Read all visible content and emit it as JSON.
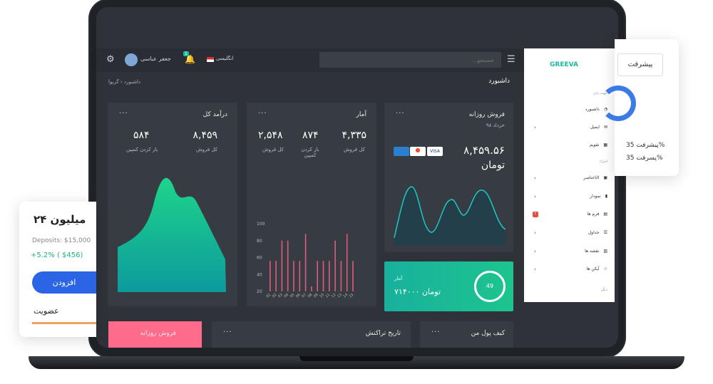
{
  "topbar": {
    "search_placeholder": "جستجو...",
    "language": "انگلیسی",
    "user_name": "جعفر عباسی",
    "notif_count": "1"
  },
  "header": {
    "page_title": "داشبورد",
    "breadcrumb": [
      "داشبورد",
      "گریوا"
    ]
  },
  "sidebar": {
    "logo": "GREEVA",
    "section_nav": "جهت یابی",
    "items": [
      "داشبورد",
      "ایمیل",
      "تقویم"
    ],
    "section_elements": "اجزاء",
    "items2": [
      "عناصرUI",
      "نمودار",
      "فرم ها",
      "جداول",
      "نقشه ها",
      "آیکن ها"
    ],
    "form_badge": "۲",
    "section_other": "دیگر"
  },
  "card_income": {
    "title": "درآمد کل",
    "v1": "۸,۴۵۹",
    "l1": "کل فروش",
    "v2": "۵۸۴",
    "l2": "باز کردن کمپین"
  },
  "card_stats": {
    "title": "آمار",
    "v1": "۴,۳۳۵",
    "l1": "کل فروش",
    "v2": "۸۷۴",
    "l2": "باز کردن کمپین",
    "v3": "۲,۵۴۸",
    "l3": "کل فروش"
  },
  "card_daily": {
    "title": "فروش روزانه",
    "subtitle": "خرداد ۹۸",
    "amount": "۸,۴۵۹.۵۶",
    "currency": "تومان"
  },
  "card_stats2": {
    "title": "آمار",
    "amount": "۷۱۴۰۰۰ تومان",
    "progress": 49
  },
  "bottom": {
    "daily_sales": "فروش روزانه",
    "transactions": "تاریخ تراکنش",
    "wallet": "کیف پول من"
  },
  "left_float": {
    "amount": "۲۴ میلیون",
    "deposits": "Deposits: $15,000",
    "change": "+5.2% ( $456)",
    "button": "افزودن",
    "membership": "عضویت"
  },
  "right_float": {
    "button": "پیشرفت",
    "l1": "پیشرفت",
    "v1": "35%",
    "l2": "پسرفت",
    "v2": "35%"
  },
  "chart_data": {
    "type": "bar",
    "y_ticks": [
      "100",
      "80",
      "60",
      "40",
      "20"
    ],
    "categories": [
      "01",
      "02",
      "03",
      "04",
      "05",
      "06",
      "07",
      "08",
      "09",
      "10",
      "11",
      "12",
      "13",
      "14",
      "15"
    ],
    "values": [
      56,
      56,
      80,
      80,
      56,
      56,
      88,
      26,
      56,
      56,
      56,
      80,
      56,
      88,
      56
    ],
    "ylim": [
      20,
      100
    ]
  },
  "colors": {
    "accent": "#1eb89e",
    "bar": "#e05a7a",
    "pink": "#ff6b8a",
    "blue": "#2c64e6"
  }
}
